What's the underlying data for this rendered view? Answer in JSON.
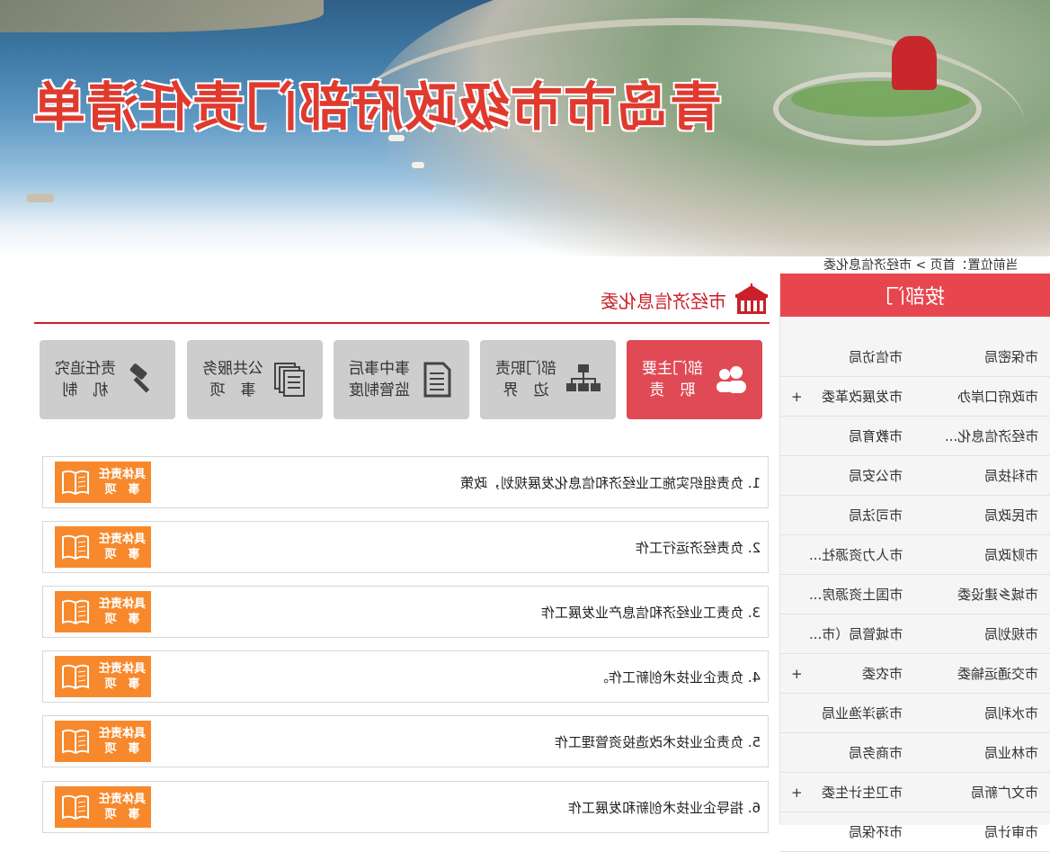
{
  "banner": {
    "title": "青岛市市级政府部门责任清单"
  },
  "breadcrumb": {
    "text": "当前位置：首页 > 市经济信息化委"
  },
  "sidebar": {
    "title": "按部门",
    "rows": [
      {
        "left": "市信访局",
        "right": "市保密局",
        "left_plus": ""
      },
      {
        "left": "市发展改革委",
        "right": "市政府口岸办",
        "left_plus": "+"
      },
      {
        "left": "市教育局",
        "right": "市经济信息化...",
        "left_plus": ""
      },
      {
        "left": "市公安局",
        "right": "市科技局",
        "left_plus": ""
      },
      {
        "left": "市司法局",
        "right": "市民政局",
        "left_plus": ""
      },
      {
        "left": "市人力资源社...",
        "right": "市财政局",
        "left_plus": ""
      },
      {
        "left": "市国土资源房...",
        "right": "市城乡建设委",
        "left_plus": ""
      },
      {
        "left": "市城管局（市...",
        "right": "市规划局",
        "left_plus": ""
      },
      {
        "left": "市农委",
        "right": "市交通运输委",
        "left_plus": "+"
      },
      {
        "left": "市海洋渔业局",
        "right": "市水利局",
        "left_plus": ""
      },
      {
        "left": "市商务局",
        "right": "市林业局",
        "left_plus": ""
      },
      {
        "left": "市卫生计生委",
        "right": "市文广新局",
        "left_plus": "+"
      },
      {
        "left": "市环保局",
        "right": "市审计局",
        "left_plus": ""
      }
    ]
  },
  "main": {
    "dept_title": "市经济信息化委",
    "tabs": [
      {
        "label": "部门主要\n职　责",
        "icon": "people-icon",
        "active": true
      },
      {
        "label": "部门职责\n边　界",
        "icon": "org-chart-icon",
        "active": false
      },
      {
        "label": "事中事后\n监管制度",
        "icon": "document-icon",
        "active": false
      },
      {
        "label": "公共服务\n事　项",
        "icon": "documents-stack-icon",
        "active": false
      },
      {
        "label": "责任追究\n机　制",
        "icon": "gavel-icon",
        "active": false
      }
    ],
    "badge_label": "具体责任\n事　项",
    "items": [
      "1. 负责组织实施工业经济和信息化发展规划，政策",
      "2. 负责经济运行工作",
      "3. 负责工业经济和信息产业发展工作",
      "4. 负责企业技术创新工作。",
      "5. 负责企业技术改造投资管理工作",
      "6. 指导企业技术创新和发展工作"
    ]
  },
  "colors": {
    "accent": "#e04a55",
    "badge": "#f7892c",
    "title_red": "#c9202a"
  }
}
